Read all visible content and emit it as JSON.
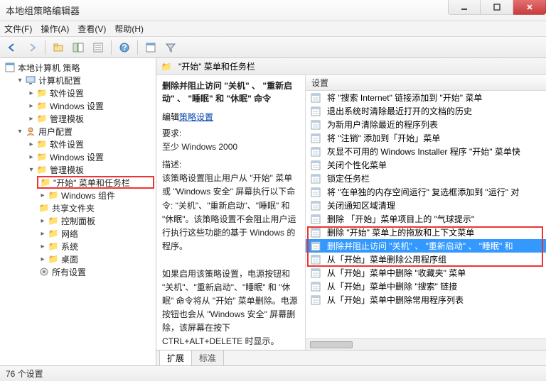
{
  "window": {
    "title": "本地组策略编辑器"
  },
  "menu": {
    "file": "文件(F)",
    "action": "操作(A)",
    "view": "查看(V)",
    "help": "帮助(H)"
  },
  "toolbar_icons": [
    "back",
    "forward",
    "up",
    "show-hide-tree",
    "export",
    "help",
    "properties",
    "filter"
  ],
  "tree": {
    "root": "本地计算机 策略",
    "computer": {
      "label": "计算机配置",
      "children": [
        "软件设置",
        "Windows 设置",
        "管理模板"
      ]
    },
    "user": {
      "label": "用户配置",
      "soft": "软件设置",
      "win": "Windows 设置",
      "admin": {
        "label": "管理模板",
        "children": [
          "\"开始\" 菜单和任务栏",
          "Windows 组件",
          "共享文件夹",
          "控制面板",
          "网络",
          "系统",
          "桌面",
          "所有设置"
        ]
      }
    }
  },
  "right": {
    "header": "\"开始\" 菜单和任务栏",
    "policy_title": "删除并阻止访问 \"关机\" 、 \"重新启动\" 、 \"睡眠\" 和 \"休眠\" 命令",
    "edit_prefix": "编辑",
    "edit_link": "策略设置",
    "req_label": "要求:",
    "req_value": "至少 Windows 2000",
    "desc_label": "描述:",
    "desc": "该策略设置阻止用户从 \"开始\" 菜单或 \"Windows 安全\" 屏幕执行以下命令: \"关机\"、\"重新启动\"、\"睡眠\" 和 \"休眠\"。该策略设置不会阻止用户运行执行这些功能的基于 Windows 的程序。\n\n如果启用该策略设置，电源按钮和 \"关机\"、\"重新启动\"、\"睡眠\" 和 \"休眠\" 命令将从 \"开始\" 菜单删除。电源按钮也会从 \"Windows 安全\" 屏幕删除，该屏幕在按下 CTRL+ALT+DELETE 时显示。"
  },
  "settings_header": "设置",
  "settings": [
    "将 \"搜索 Internet\" 链接添加到 \"开始\" 菜单",
    "退出系统时清除最近打开的文档的历史",
    "为新用户清除最近的程序列表",
    "将 \"注销\" 添加到「开始」菜单",
    "灰显不可用的 Windows Installer 程序 \"开始\" 菜单快",
    "关闭个性化菜单",
    "锁定任务栏",
    "将 \"在单独的内存空间运行\" 复选框添加到 \"运行\" 对",
    "关闭通知区域清理",
    "删除 「开始」菜单项目上的 \"气球提示\"",
    "删除 \"开始\" 菜单上的拖放和上下文菜单",
    "删除并阻止访问 \"关机\" 、 \"重新启动\" 、 \"睡眠\" 和",
    "从「开始」菜单删除公用程序组",
    "从「开始」菜单中删除 \"收藏夹\" 菜单",
    "从「开始」菜单中删除 \"搜索\" 链接",
    "从「开始」菜单中删除常用程序列表"
  ],
  "selected_index": 11,
  "tabs": {
    "extended": "扩展",
    "standard": "标准"
  },
  "status": "76 个设置"
}
